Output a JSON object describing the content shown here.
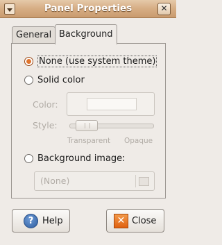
{
  "window": {
    "title": "Panel Properties"
  },
  "tabs": [
    {
      "label": "General"
    },
    {
      "label": "Background",
      "selected": true
    }
  ],
  "background": {
    "options": [
      {
        "label": "None (use system theme)",
        "checked": true
      },
      {
        "label": "Solid color",
        "checked": false
      },
      {
        "label": "Background image:",
        "checked": false
      }
    ],
    "color_label": "Color:",
    "style_label": "Style:",
    "slider": {
      "min_label": "Transparent",
      "max_label": "Opaque",
      "value_fraction": 0.15
    },
    "image_combo": {
      "value": "(None)"
    }
  },
  "buttons": {
    "help": "Help",
    "close": "Close"
  },
  "colors": {
    "accent": "#e0742d",
    "titlebar": "#d6ad84",
    "disabled_text": "#b1aca6"
  }
}
